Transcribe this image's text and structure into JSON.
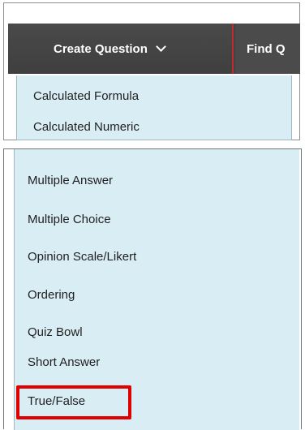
{
  "toolbar": {
    "create_question_label": "Create Question",
    "find_questions_label": "Find Q"
  },
  "menu_top": {
    "items": [
      {
        "label": "Calculated Formula"
      },
      {
        "label": "Calculated Numeric"
      }
    ]
  },
  "menu_bottom": {
    "items": [
      {
        "label": "Multiple Answer"
      },
      {
        "label": "Multiple Choice"
      },
      {
        "label": "Opinion Scale/Likert"
      },
      {
        "label": "Ordering"
      },
      {
        "label": "Quiz Bowl"
      },
      {
        "label": "Short Answer"
      },
      {
        "label": "True/False"
      }
    ]
  },
  "colors": {
    "toolbar_bg": "#434343",
    "menu_bg": "#d9edf4",
    "highlight_border": "#e00000"
  },
  "icons": {
    "dropdown": "chevron-down-icon"
  }
}
